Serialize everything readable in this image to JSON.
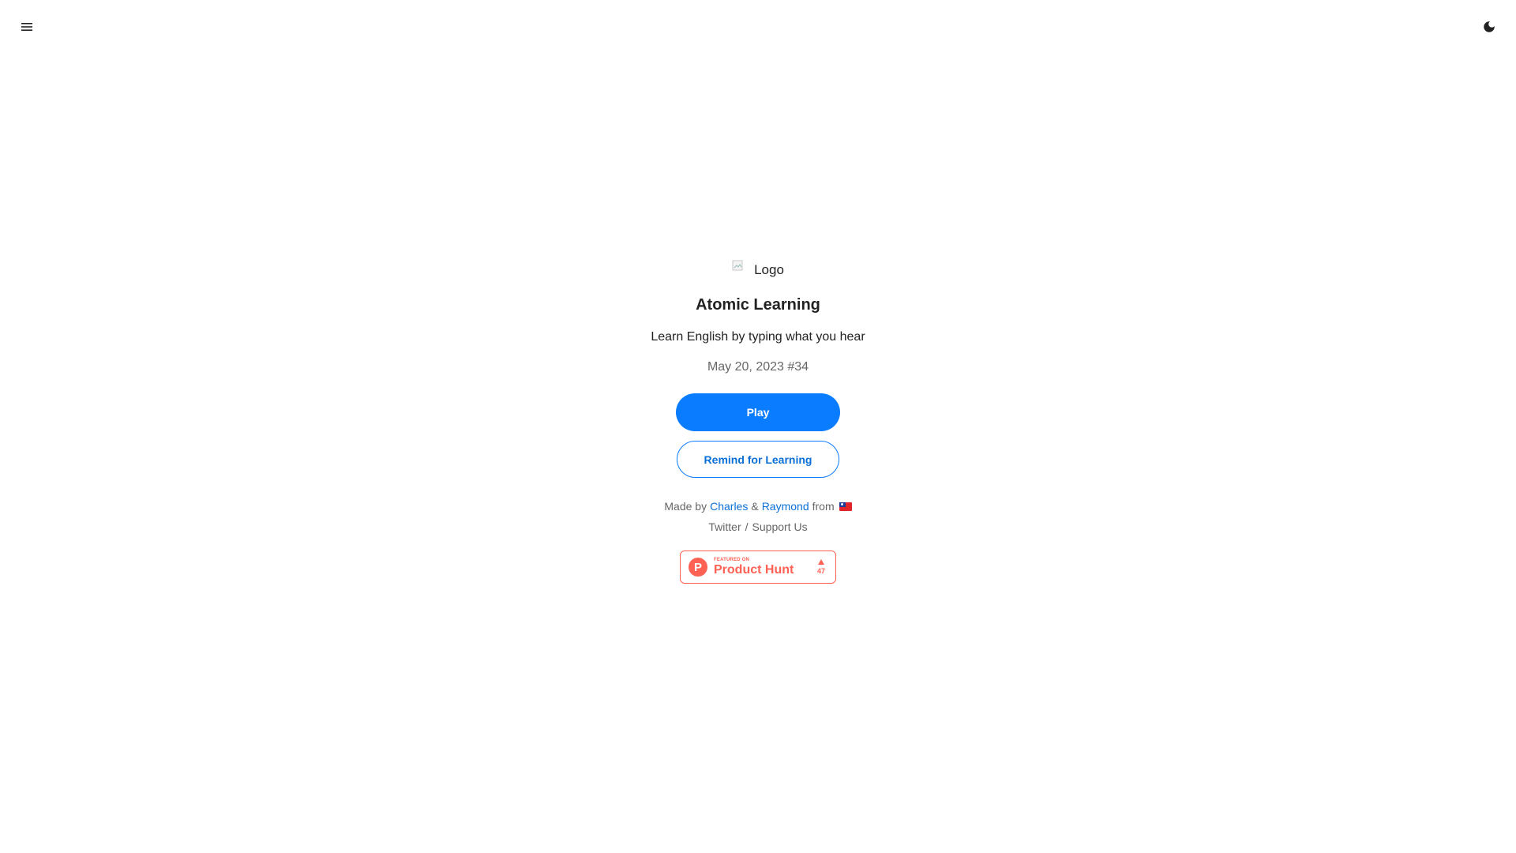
{
  "header": {
    "menu_icon": "hamburger-menu-icon",
    "theme_icon": "moon-icon"
  },
  "hero": {
    "logo_alt": "Logo",
    "title": "Atomic Learning",
    "subtitle": "Learn English by typing what you hear",
    "date_issue": "May 20, 2023 #34"
  },
  "actions": {
    "play_label": "Play",
    "remind_label": "Remind for Learning"
  },
  "credits": {
    "made_by": "Made by",
    "author1": "Charles",
    "ampersand": "&",
    "author2": "Raymond",
    "from": "from",
    "flag_icon": "taiwan-flag-icon"
  },
  "links": {
    "twitter": "Twitter",
    "separator": "/",
    "support": "Support Us"
  },
  "product_hunt": {
    "featured_on": "FEATURED ON",
    "name": "Product Hunt",
    "logo_letter": "P",
    "votes": "47"
  },
  "colors": {
    "primary": "#0a7cff",
    "product_hunt": "#ff6154",
    "muted_text": "#666666"
  }
}
